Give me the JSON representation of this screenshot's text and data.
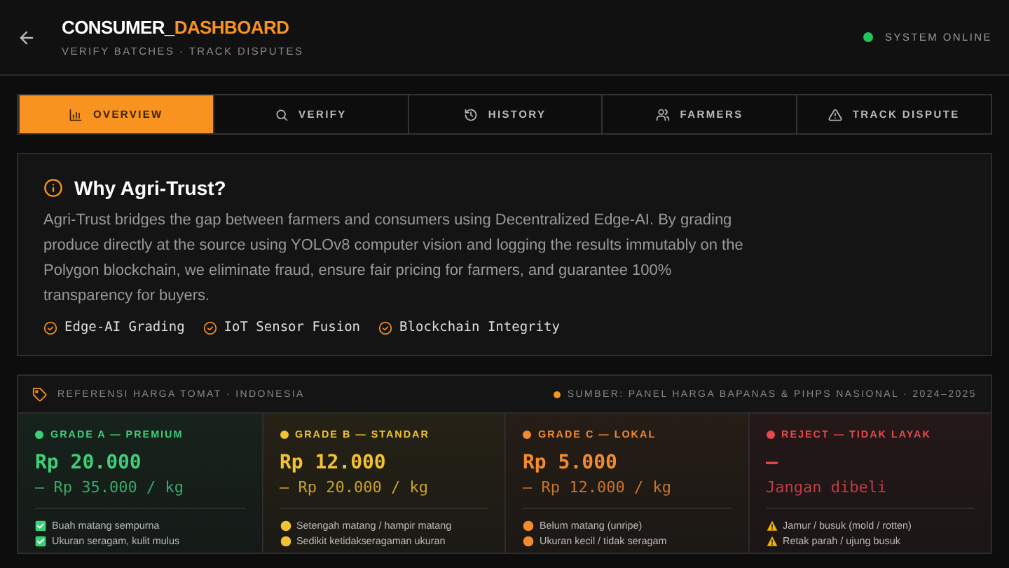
{
  "header": {
    "title_main": "CONSUMER_",
    "title_accent": "DASHBOARD",
    "subtitle": "VERIFY BATCHES · TRACK DISPUTES",
    "status": {
      "label": "SYSTEM ONLINE",
      "color": "#22c55e"
    }
  },
  "tabs": [
    {
      "label": "OVERVIEW",
      "selected": true
    },
    {
      "label": "VERIFY",
      "selected": false
    },
    {
      "label": "HISTORY",
      "selected": false
    },
    {
      "label": "FARMERS",
      "selected": false
    },
    {
      "label": "TRACK DISPUTE",
      "selected": false
    }
  ],
  "info": {
    "title": "Why Agri-Trust?",
    "body": "Agri-Trust bridges the gap between farmers and consumers using Decentralized Edge-AI. By grading produce directly at the source using YOLOv8 computer vision and logging the results immutably on the Polygon blockchain, we eliminate fraud, ensure fair pricing for farmers, and guarantee 100% transparency for buyers.",
    "features": [
      "Edge-AI Grading",
      "IoT Sensor Fusion",
      "Blockchain Integrity"
    ]
  },
  "prices": {
    "title": "REFERENSI HARGA TOMAT · INDONESIA",
    "source": "SUMBER: PANEL HARGA BAPANAS & PIHPS NASIONAL · 2024–2025",
    "grades": [
      {
        "label": "GRADE A — PREMIUM",
        "color": "#3ecf7a",
        "price": "Rp 20.000",
        "range": "– Rp 35.000 / kg",
        "kind": "check",
        "notes": [
          "Buah matang sempurna",
          "Ukuran seragam, kulit mulus"
        ]
      },
      {
        "label": "GRADE B — STANDAR",
        "color": "#f2c230",
        "price": "Rp 12.000",
        "range": "– Rp 20.000 / kg",
        "kind": "dot",
        "notes": [
          "Setengah matang / hampir matang",
          "Sedikit ketidakseragaman ukuran"
        ]
      },
      {
        "label": "GRADE C — LOKAL",
        "color": "#f28a30",
        "price": "Rp 5.000",
        "range": "– Rp 12.000 / kg",
        "kind": "dot",
        "notes": [
          "Belum matang (unripe)",
          "Ukuran kecil / tidak seragam"
        ]
      },
      {
        "label": "REJECT — TIDAK LAYAK",
        "color": "#e5484d",
        "price": "—",
        "range": "Jangan dibeli",
        "kind": "warning",
        "notes": [
          "Jamur / busuk (mold / rotten)",
          "Retak parah / ujung busuk"
        ]
      }
    ]
  }
}
